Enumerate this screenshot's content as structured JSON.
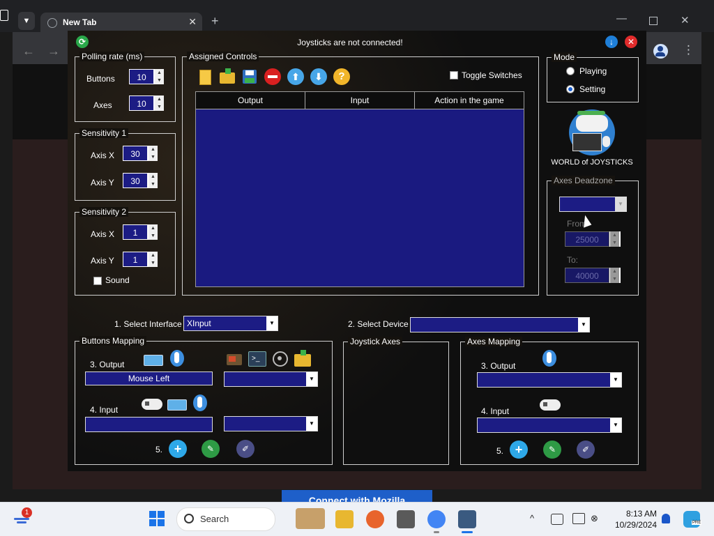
{
  "browser": {
    "tab_title": "New Tab",
    "new_tab_glyph": "+",
    "banner_text": "Connect with Mozilla"
  },
  "app": {
    "title": "Joysticks are not connected!",
    "polling": {
      "label": "Polling rate (ms)",
      "buttons_label": "Buttons",
      "buttons_value": "10",
      "axes_label": "Axes",
      "axes_value": "10"
    },
    "sensitivity1": {
      "label": "Sensitivity 1",
      "x_label": "Axis X",
      "x_value": "30",
      "y_label": "Axis Y",
      "y_value": "30"
    },
    "sensitivity2": {
      "label": "Sensitivity 2",
      "x_label": "Axis X",
      "x_value": "1",
      "y_label": "Axis Y",
      "y_value": "1",
      "sound_label": "Sound"
    },
    "assigned": {
      "label": "Assigned Controls",
      "toggle_label": "Toggle Switches",
      "columns": [
        "Output",
        "Input",
        "Action in the game"
      ]
    },
    "mode": {
      "label": "Mode",
      "playing": "Playing",
      "setting": "Setting",
      "selected": "Setting"
    },
    "logo_text": "WORLD of JOYSTICKS",
    "deadzone": {
      "label": "Axes Deadzone",
      "from_label": "From",
      "from_value": "25000",
      "to_label": "To:",
      "to_value": "40000"
    },
    "select_interface_label": "1. Select Interface",
    "select_interface_value": "XInput",
    "select_device_label": "2. Select Device",
    "buttons_mapping": {
      "label": "Buttons Mapping",
      "output_label": "3. Output",
      "output_value": "Mouse Left",
      "input_label": "4. Input",
      "step5_label": "5."
    },
    "joystick_axes_label": "Joystick Axes",
    "axes_mapping": {
      "label": "Axes Mapping",
      "output_label": "3. Output",
      "input_label": "4. Input",
      "step5_label": "5."
    }
  },
  "taskbar": {
    "search_placeholder": "Search",
    "notification_count": "1",
    "time": "8:13 AM",
    "date": "10/29/2024",
    "pre_badge": "PRE"
  },
  "colors": {
    "field_blue": "#1c1c84",
    "table_blue": "#1a1a80",
    "taskbar": "#eef1f6"
  }
}
